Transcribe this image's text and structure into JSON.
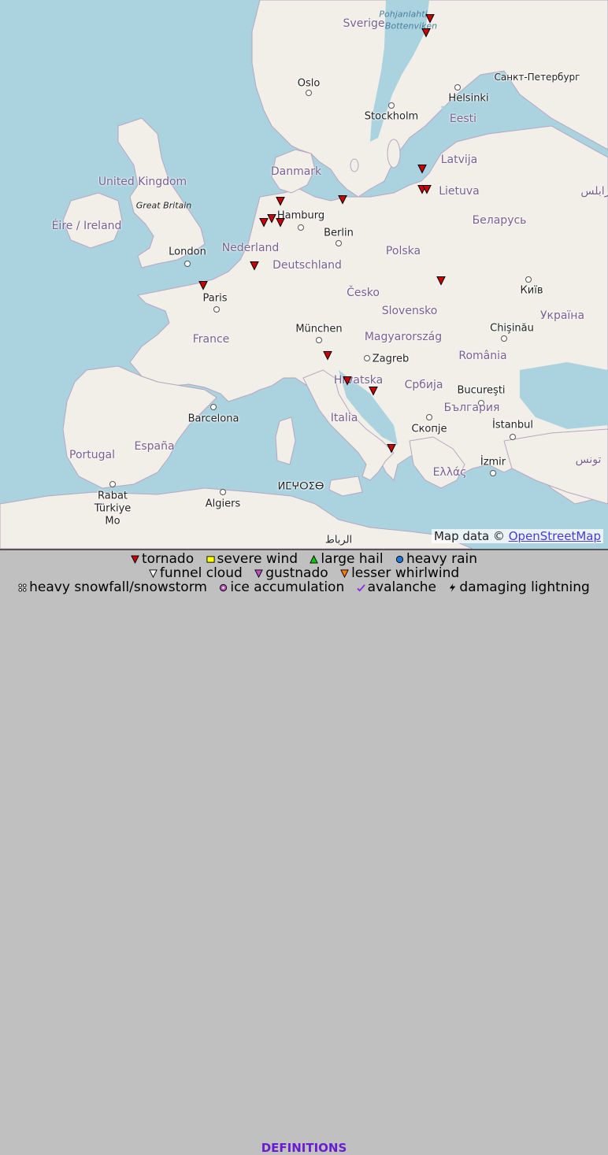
{
  "map": {
    "cities": [
      "Oslo",
      "Stockholm",
      "Helsinki",
      "Санкт-Петербург",
      "Hamburg",
      "Berlin",
      "London",
      "Paris",
      "München",
      "Zagreb",
      "Bucureşti",
      "Chişinău",
      "Київ",
      "Barcelona",
      "Скопје",
      "İstanbul",
      "İzmir",
      "Algiers",
      "Rabat",
      "Eesti",
      "Latvija",
      "Lietuva",
      "Беларусь",
      "Polska",
      "Česko",
      "Slovensko",
      "Magyarország",
      "România",
      "Србија",
      "България",
      "Italia",
      "Hrvatska",
      "Deutschland",
      "Nederland",
      "France",
      "España",
      "Portugal",
      "Danmark",
      "Sverige",
      "United Kingdom",
      "Éire / Ireland",
      "Great Britain",
      "Україна",
      "Ελλάς",
      "Türkiye",
      "Mo",
      "ⵍⵎⵖⵔⵉⴱ",
      "الرباط",
      "تونس",
      "طرابلس",
      "Pohjanlahti",
      "Bottenviken"
    ],
    "attribution_prefix": "Map data © ",
    "attribution_link": "OpenStreetMap",
    "marker_count": 20
  },
  "legend": {
    "row1": [
      "tornado",
      "severe wind",
      "large hail",
      "heavy rain"
    ],
    "row2": [
      "funnel cloud",
      "gustnado",
      "lesser whirlwind"
    ],
    "row3": [
      "heavy snowfall/snowstorm",
      "ice accumulation",
      "avalanche",
      "damaging lightning"
    ],
    "definitions": "DEFINITIONS"
  },
  "colors": {
    "sea": "#aad3df",
    "land": "#f2efe9",
    "tornado": "#cc0000",
    "severe_wind": "#ffff00",
    "large_hail": "#00cc00",
    "heavy_rain": "#1e78d8",
    "funnel_cloud": "#ffffff",
    "gustnado": "#c050c0",
    "lesser_whirlwind": "#ff7a00"
  }
}
